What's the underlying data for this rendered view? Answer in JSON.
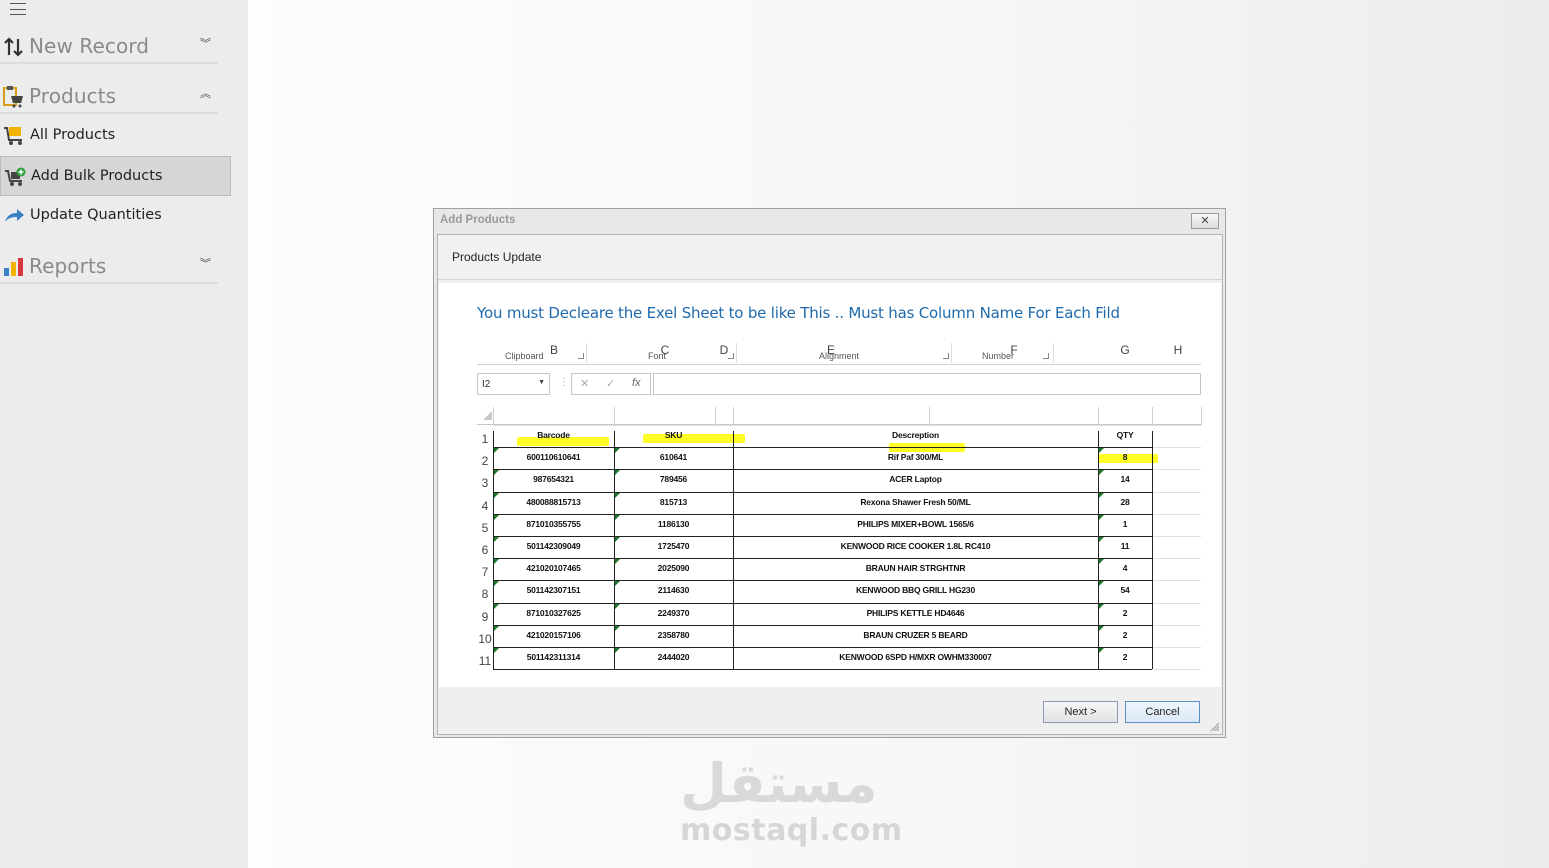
{
  "sidebar": {
    "groups": [
      {
        "label": "New Record",
        "icon": "up-down-arrows-icon",
        "state": "collapsed"
      },
      {
        "label": "Products",
        "icon": "products-clipboard-icon",
        "state": "expanded"
      },
      {
        "label": "Reports",
        "icon": "bar-chart-icon",
        "state": "collapsed"
      }
    ],
    "items": [
      {
        "label": "All Products",
        "icon": "cart-icon"
      },
      {
        "label": "Add Bulk Products",
        "icon": "cart-add-icon",
        "active": true
      },
      {
        "label": "Update Quantities",
        "icon": "share-arrow-icon"
      }
    ]
  },
  "dialog": {
    "title": "Add Products",
    "close_label": "✕",
    "step_title": "Products Update",
    "instruction": "You must Decleare the Exel Sheet to be like This .. Must has Column Name For Each Fild",
    "next_label": "Next >",
    "cancel_label": "Cancel"
  },
  "sheet": {
    "ribbon_groups": [
      "Clipboard",
      "Font",
      "Alignment",
      "Number"
    ],
    "name_box": "I2",
    "fx_icons": [
      "✕",
      "✓",
      "fx"
    ],
    "column_letters": [
      "B",
      "C",
      "D",
      "E",
      "F",
      "G",
      "H"
    ],
    "row_numbers": [
      "1",
      "2",
      "3",
      "4",
      "5",
      "6",
      "7",
      "8",
      "9",
      "10",
      "11"
    ],
    "headers": [
      "Barcode",
      "SKU",
      "Descreption",
      "QTY"
    ],
    "rows": [
      [
        "600110610641",
        "610641",
        "Rif Paf 300/ML",
        "8"
      ],
      [
        "987654321",
        "789456",
        "ACER Laptop",
        "14"
      ],
      [
        "480088815713",
        "815713",
        "Rexona Shawer Fresh 50/ML",
        "28"
      ],
      [
        "871010355755",
        "1186130",
        "PHILIPS MIXER+BOWL 1565/6",
        "1"
      ],
      [
        "501142309049",
        "1725470",
        "KENWOOD RICE COOKER 1.8L RC410",
        "11"
      ],
      [
        "421020107465",
        "2025090",
        "BRAUN HAIR STRGHTNR",
        "4"
      ],
      [
        "501142307151",
        "2114630",
        "KENWOOD BBQ GRILL HG230",
        "54"
      ],
      [
        "871010327625",
        "2249370",
        "PHILIPS KETTLE HD4646",
        "2"
      ],
      [
        "421020157106",
        "2358780",
        "BRAUN CRUZER 5 BEARD",
        "2"
      ],
      [
        "501142311314",
        "2444020",
        "KENWOOD 6SPD H/MXR OWHM330007",
        "2"
      ]
    ],
    "highlight_color": "#ffff00"
  },
  "watermark": {
    "arabic": "مستقل",
    "latin": "mostaql.com"
  },
  "colors": {
    "sidebar_bg": "#ececec",
    "active_item_bg": "#d6d6d6",
    "instruction_text": "#1f6aad",
    "group_label": "#8a8a8a"
  }
}
